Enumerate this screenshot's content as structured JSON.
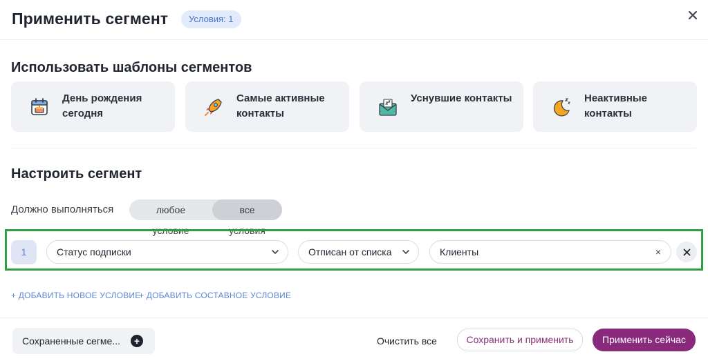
{
  "header": {
    "title": "Применить сегмент",
    "conditions_badge": "Условия: 1"
  },
  "templates": {
    "heading": "Использовать шаблоны сегментов",
    "items": [
      {
        "label": "День рождения сегодня",
        "icon": "birthday-calendar-icon"
      },
      {
        "label": "Самые активные контакты",
        "icon": "rocket-icon"
      },
      {
        "label": "Уснувшие контакты",
        "icon": "sleeping-envelope-icon"
      },
      {
        "label": "Неактивные контакты",
        "icon": "moon-icon"
      }
    ]
  },
  "configure": {
    "heading": "Настроить сегмент",
    "must_label": "Должно выполняться",
    "toggle": {
      "any": "любое условие",
      "all": "все условия",
      "selected": "all"
    },
    "condition": {
      "number": "1",
      "field": "Статус подписки",
      "operator": "Отписан от списка",
      "value": "Клиенты",
      "clear_glyph": "×"
    },
    "add_condition": "+ ДОБАВИТЬ НОВОЕ УСЛОВИЕ",
    "add_composite": "+ ДОБАВИТЬ СОСТАВНОЕ УСЛОВИЕ"
  },
  "footer": {
    "saved_segments": "Сохраненные сегме...",
    "clear_all": "Очистить все",
    "save_and_apply": "Сохранить и применить",
    "apply_now": "Применить сейчас"
  },
  "colors": {
    "primary": "#8a2a7c",
    "highlight_border": "#2ea043",
    "badge_bg": "#e2ebfb",
    "link": "#5c87d6"
  }
}
